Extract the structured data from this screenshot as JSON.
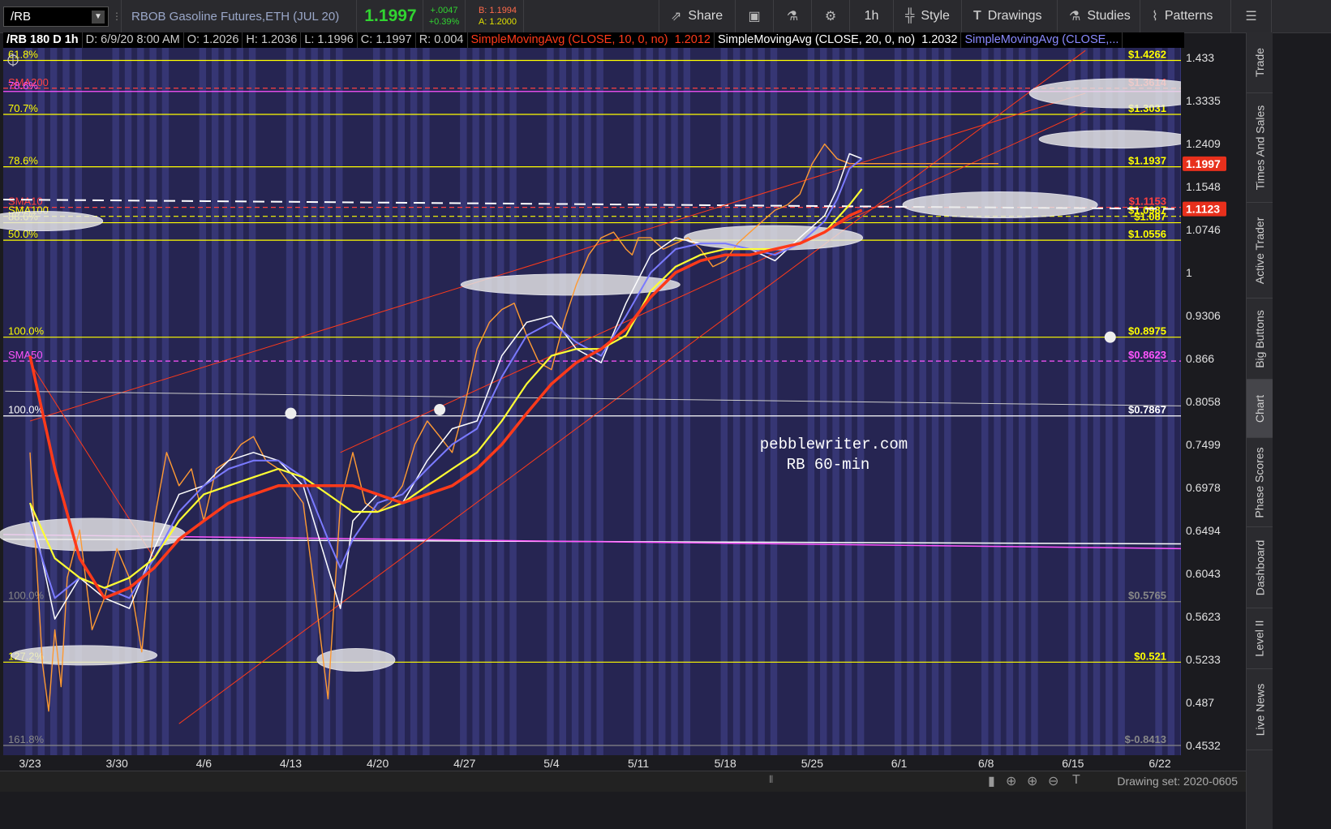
{
  "toolbar": {
    "symbol": "/RB",
    "description": "RBOB Gasoline Futures,ETH (JUL 20)",
    "last": "1.1997",
    "change": "+.0047",
    "change_pct": "+0.39%",
    "bid": "B: 1.1994",
    "ask": "A: 1.2000",
    "share": "Share",
    "timeframe": "1h",
    "style": "Style",
    "drawings": "Drawings",
    "studies": "Studies",
    "patterns": "Patterns"
  },
  "titlebar": {
    "symbol_period": "/RB 180 D 1h",
    "date": "D: 6/9/20 8:00 AM",
    "open": "O: 1.2026",
    "high": "H: 1.2036",
    "low": "L: 1.1996",
    "close": "C: 1.1997",
    "range": "R: 0.004",
    "sma10_label": "SimpleMovingAvg (CLOSE, 10, 0, no)",
    "sma10_value": "1.2012",
    "sma20_label": "SimpleMovingAvg (CLOSE, 20, 0, no)",
    "sma20_value": "1.2032",
    "sma3_label": "SimpleMovingAvg (CLOSE,..."
  },
  "sidebar": [
    "Trade",
    "Times And Sales",
    "Active Trader",
    "Big Buttons",
    "Chart",
    "Phase Scores",
    "Dashboard",
    "Level II",
    "Live News"
  ],
  "bottombar": {
    "drawing_set": "Drawing set: 2020-0605"
  },
  "colors": {
    "background": "#262552",
    "stripe": "#3a3a7a",
    "sma10": "#ffffff",
    "sma20": "#7a7aff",
    "sma50": "#ffff33",
    "sma100": "#ff3a1a",
    "fib": "#ffff00",
    "channel": "#ff3a1a",
    "pink": "#ff55ff"
  },
  "watermark": [
    "pebblewriter.com",
    "RB 60-min"
  ],
  "chart_data": {
    "type": "line",
    "title": "/RB 180 D 1h",
    "xlabel": "",
    "ylabel": "",
    "x_ticks": [
      "3/23",
      "3/30",
      "4/6",
      "4/13",
      "4/20",
      "4/27",
      "5/4",
      "5/11",
      "5/18",
      "5/25",
      "6/1",
      "6/8",
      "6/15",
      "6/22"
    ],
    "y_ticks": [
      "1.433",
      "1.3335",
      "1.2409",
      "1.1548",
      "1.0746",
      "1",
      "0.9306",
      "0.866",
      "0.8058",
      "0.7499",
      "0.6978",
      "0.6494",
      "0.6043",
      "0.5623",
      "0.5233",
      "0.487",
      "0.4532"
    ],
    "ylim": [
      0.4532,
      1.433
    ],
    "y_scale": "log",
    "last_price": "1.1997",
    "sma_badge": "1.1123",
    "series": [
      {
        "name": "Price",
        "x": [
          0,
          0.5,
          1,
          1.5,
          2,
          2.5,
          3,
          4,
          5,
          6,
          7,
          8,
          9,
          10,
          11,
          12,
          13,
          14,
          15,
          16,
          17,
          18,
          19,
          20,
          21,
          22,
          23,
          24,
          25,
          26,
          27,
          28,
          29,
          30,
          31,
          32,
          33,
          34,
          35,
          36,
          37,
          38,
          39,
          40,
          41,
          42,
          43,
          44,
          45,
          46,
          47,
          48,
          48.5,
          49,
          50,
          51,
          52,
          53,
          54,
          55,
          56,
          57,
          58,
          59,
          60,
          61,
          62,
          63,
          64,
          65,
          66,
          67,
          68,
          69,
          70,
          71,
          72,
          73,
          74,
          75,
          76,
          77,
          78
        ],
        "values": [
          0.74,
          0.62,
          0.52,
          0.48,
          0.55,
          0.5,
          0.6,
          0.65,
          0.55,
          0.58,
          0.63,
          0.6,
          0.53,
          0.66,
          0.74,
          0.7,
          0.72,
          0.66,
          0.72,
          0.73,
          0.75,
          0.76,
          0.73,
          0.72,
          0.7,
          0.68,
          0.58,
          0.49,
          0.68,
          0.74,
          0.68,
          0.67,
          0.68,
          0.7,
          0.75,
          0.78,
          0.76,
          0.74,
          0.8,
          0.88,
          0.92,
          0.94,
          0.95,
          0.9,
          0.86,
          0.85,
          0.92,
          0.98,
          1.03,
          1.06,
          1.07,
          1.04,
          1.03,
          1.06,
          1.06,
          1.04,
          1.05,
          1.06,
          1.04,
          1.01,
          1.02,
          1.05,
          1.07,
          1.09,
          1.11,
          1.12,
          1.14,
          1.2,
          1.24,
          1.21,
          1.2,
          1.2,
          1.2,
          1.2,
          1.2,
          1.2,
          1.2,
          1.2,
          1.2,
          1.2,
          1.2,
          1.2,
          1.2
        ]
      },
      {
        "name": "SimpleMovingAvg (CLOSE, 10, 0, no)",
        "x": [
          0,
          2,
          4,
          6,
          8,
          10,
          12,
          14,
          16,
          18,
          20,
          22,
          24,
          25,
          26,
          28,
          30,
          32,
          34,
          36,
          38,
          40,
          42,
          44,
          46,
          48,
          50,
          52,
          54,
          56,
          58,
          60,
          62,
          64,
          65,
          66,
          67
        ],
        "values": [
          0.68,
          0.56,
          0.6,
          0.58,
          0.57,
          0.63,
          0.69,
          0.7,
          0.73,
          0.74,
          0.73,
          0.7,
          0.61,
          0.57,
          0.66,
          0.69,
          0.68,
          0.73,
          0.77,
          0.78,
          0.87,
          0.92,
          0.93,
          0.88,
          0.86,
          0.95,
          1.03,
          1.06,
          1.05,
          1.05,
          1.04,
          1.02,
          1.06,
          1.1,
          1.15,
          1.22,
          1.21
        ]
      },
      {
        "name": "SimpleMovingAvg (CLOSE, 20, 0, no)",
        "x": [
          0,
          2,
          4,
          6,
          8,
          10,
          12,
          14,
          16,
          18,
          20,
          22,
          24,
          25,
          26,
          28,
          30,
          32,
          34,
          36,
          38,
          40,
          42,
          44,
          46,
          48,
          50,
          52,
          54,
          56,
          58,
          60,
          62,
          64,
          65,
          66,
          67
        ],
        "values": [
          0.66,
          0.58,
          0.6,
          0.59,
          0.58,
          0.62,
          0.67,
          0.7,
          0.72,
          0.73,
          0.73,
          0.71,
          0.64,
          0.61,
          0.64,
          0.68,
          0.69,
          0.72,
          0.75,
          0.77,
          0.84,
          0.9,
          0.92,
          0.89,
          0.87,
          0.93,
          1.0,
          1.04,
          1.05,
          1.05,
          1.04,
          1.03,
          1.05,
          1.09,
          1.13,
          1.19,
          1.21
        ]
      },
      {
        "name": "SMA50",
        "x": [
          0,
          2,
          4,
          6,
          8,
          10,
          12,
          14,
          16,
          18,
          20,
          22,
          24,
          26,
          28,
          30,
          32,
          34,
          36,
          38,
          40,
          42,
          44,
          46,
          48,
          50,
          52,
          54,
          56,
          58,
          60,
          62,
          64,
          66,
          67
        ],
        "values": [
          0.68,
          0.62,
          0.6,
          0.59,
          0.6,
          0.62,
          0.66,
          0.69,
          0.7,
          0.71,
          0.72,
          0.71,
          0.69,
          0.67,
          0.67,
          0.68,
          0.7,
          0.72,
          0.74,
          0.78,
          0.83,
          0.87,
          0.88,
          0.88,
          0.9,
          0.97,
          1.01,
          1.03,
          1.04,
          1.04,
          1.04,
          1.05,
          1.07,
          1.12,
          1.15
        ]
      },
      {
        "name": "SMA100",
        "x": [
          0,
          2,
          4,
          6,
          8,
          10,
          12,
          14,
          16,
          18,
          20,
          22,
          24,
          26,
          28,
          30,
          32,
          34,
          36,
          38,
          40,
          42,
          44,
          46,
          48,
          50,
          52,
          54,
          56,
          58,
          60,
          62,
          64,
          66,
          67
        ],
        "values": [
          0.87,
          0.72,
          0.62,
          0.58,
          0.59,
          0.61,
          0.64,
          0.66,
          0.68,
          0.69,
          0.7,
          0.7,
          0.7,
          0.7,
          0.69,
          0.68,
          0.69,
          0.7,
          0.72,
          0.75,
          0.79,
          0.83,
          0.86,
          0.88,
          0.91,
          0.96,
          1.0,
          1.02,
          1.03,
          1.03,
          1.04,
          1.05,
          1.07,
          1.1,
          1.11
        ]
      }
    ],
    "levels": [
      {
        "label": "61.8%",
        "value": 1.4262,
        "price_label": "$1.4262",
        "color": "#ffff00"
      },
      {
        "label": "SMA200",
        "value": 1.3614,
        "price_label": "$1.3614",
        "color": "#ff4040"
      },
      {
        "label": "78.6%",
        "value": 1.354,
        "price_label": "",
        "color": "#ff55ff"
      },
      {
        "label": "70.7%",
        "value": 1.3031,
        "price_label": "$1.3031",
        "color": "#ffff00"
      },
      {
        "label": "78.6%",
        "value": 1.1937,
        "price_label": "$1.1937",
        "color": "#ffff00"
      },
      {
        "label": "SMA10",
        "value": 1.1153,
        "price_label": "$1.1153",
        "color": "#ff4040"
      },
      {
        "label": "SMA100",
        "value": 1.0987,
        "price_label": "$1.0987",
        "color": "#ffff00"
      },
      {
        "label": "88.6%",
        "value": 1.087,
        "price_label": "$1.087",
        "color": "#ffff00"
      },
      {
        "label": "50.0%",
        "value": 1.0556,
        "price_label": "$1.0556",
        "color": "#ffff00"
      },
      {
        "label": "100.0%",
        "value": 0.8975,
        "price_label": "$0.8975",
        "color": "#ffff00"
      },
      {
        "label": "SMA50",
        "value": 0.8623,
        "price_label": "$0.8623",
        "color": "#ff55ff"
      },
      {
        "label": "100.0%",
        "value": 0.7867,
        "price_label": "$0.7867",
        "color": "#ffffff"
      },
      {
        "label": "100.0%",
        "value": 0.5765,
        "price_label": "$0.5765",
        "color": "#888888"
      },
      {
        "label": "127.2%",
        "value": 0.521,
        "price_label": "$0.521",
        "color": "#ffff00"
      },
      {
        "label": "161.8%",
        "value": 0.4532,
        "price_label": "$-0.8413",
        "color": "#888888"
      }
    ]
  }
}
